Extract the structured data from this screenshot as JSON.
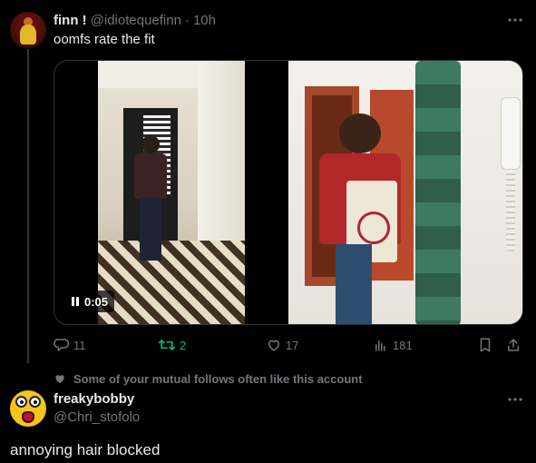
{
  "tweet": {
    "display_name": "finn !",
    "handle": "@idiotequefinn",
    "separator": "·",
    "time": "10h",
    "text": "oomfs rate the fit",
    "media": {
      "timer": "0:05"
    },
    "actions": {
      "replies": "11",
      "retweets": "2",
      "likes": "17",
      "views": "181"
    }
  },
  "social_context": "Some of your mutual follows often like this account",
  "reply": {
    "display_name": "freakybobby",
    "handle": "@Chri_stofolo",
    "text": "annoying hair blocked"
  },
  "icons": {
    "more": "more-horizontal-icon",
    "reply": "speech-bubble-icon",
    "retweet": "retweet-icon",
    "like": "heart-icon",
    "views": "bar-chart-icon",
    "bookmark": "bookmark-icon",
    "share": "share-icon",
    "social": "heart-icon",
    "pause": "pause-icon"
  },
  "colors": {
    "background": "#000000",
    "text": "#e7e9ea",
    "muted": "#71767b",
    "retweet_active": "#00ba7c",
    "thread_line": "#333639"
  }
}
